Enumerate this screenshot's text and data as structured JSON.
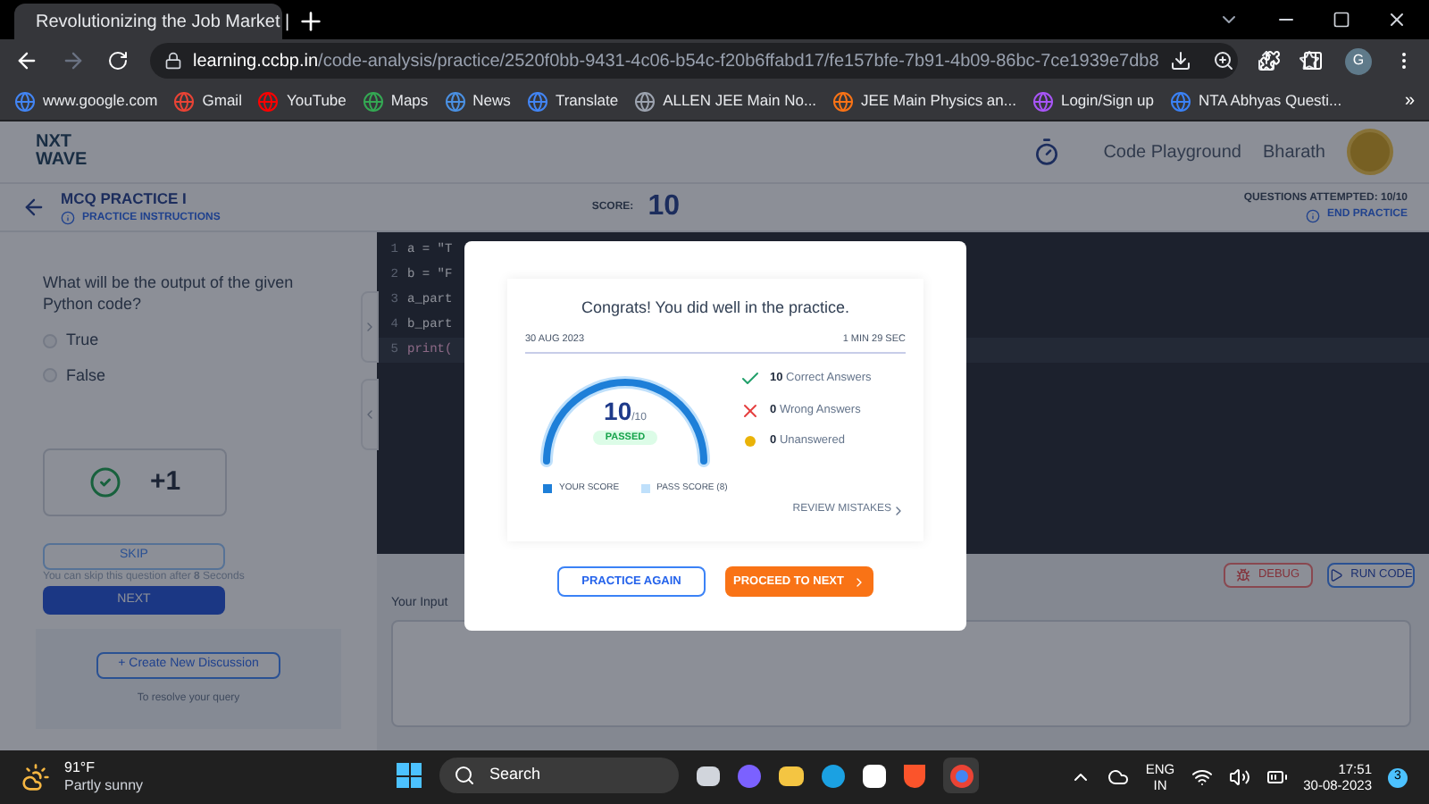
{
  "browser": {
    "tabs": [
      {
        "title": "Revolutionizing the Job Market |",
        "selected": true
      }
    ],
    "url_host": "learning.ccbp.in",
    "url_path": "/code-analysis/practice/2520f0bb-9431-4c06-b54c-f20b6ffabd17/fe157bfe-7b91-4b09-86bc-7ce1939e7db8",
    "profile": "G",
    "bookmarks": [
      "www.google.com",
      "Gmail",
      "YouTube",
      "Maps",
      "News",
      "Translate",
      "ALLEN JEE Main No...",
      "JEE Main Physics an...",
      "Login/Sign up",
      "NTA Abhyas Questi..."
    ],
    "more": "»"
  },
  "header": {
    "logo_top": "NXT",
    "logo_bottom": "WAVE",
    "nav": [
      "Code Playground",
      "Bharath"
    ]
  },
  "practice_bar": {
    "title": "MCQ PRACTICE I",
    "instructions": "PRACTICE INSTRUCTIONS",
    "score_label": "SCORE:",
    "score": "10",
    "attempted": "QUESTIONS ATTEMPTED: 10/10",
    "end": "END PRACTICE"
  },
  "question": {
    "text": "What will be the output of the given Python code?",
    "options": [
      {
        "label": "True",
        "selected": false
      },
      {
        "label": "False",
        "selected": false
      }
    ],
    "result": "+1",
    "skip": "SKIP",
    "skip_note": "You can skip this question after **8** Seconds",
    "next": "NEXT",
    "discussion_button": "+ Create New Discussion",
    "discussion_note": "To resolve your query"
  },
  "editor": {
    "lines": [
      {
        "number": "1",
        "code": "a = \"T",
        "current": false
      },
      {
        "number": "2",
        "code": "b = \"F",
        "current": false
      },
      {
        "number": "3",
        "code": "a_part",
        "current": false
      },
      {
        "number": "4",
        "code": "b_part",
        "current": false
      },
      {
        "number": "5",
        "code": "print(",
        "current": true
      }
    ],
    "debug": "DEBUG",
    "run": "RUN CODE",
    "input_label": "Your Input"
  },
  "modal": {
    "title": "Congrats! You did well in the practice.",
    "date": "30 AUG 2023",
    "duration": "1 MIN 29 SEC",
    "score": "10",
    "total": "/10",
    "status": "PASSED",
    "legend": [
      "YOUR SCORE",
      "PASS SCORE (8)"
    ],
    "stats": [
      {
        "kind": "correct",
        "count": "10",
        "label": "Correct Answers"
      },
      {
        "kind": "wrong",
        "count": "0",
        "label": "Wrong Answers"
      },
      {
        "kind": "unanswered",
        "count": "0",
        "label": "Unanswered"
      }
    ],
    "review": "REVIEW MISTAKES",
    "practice_again": "PRACTICE AGAIN",
    "proceed": "PROCEED TO NEXT"
  },
  "taskbar": {
    "temperature": "91°F",
    "weather": "Partly sunny",
    "search": "Search",
    "language": "ENG",
    "region": "IN",
    "time": "17:51",
    "date": "30-08-2023",
    "notifications": "3"
  }
}
